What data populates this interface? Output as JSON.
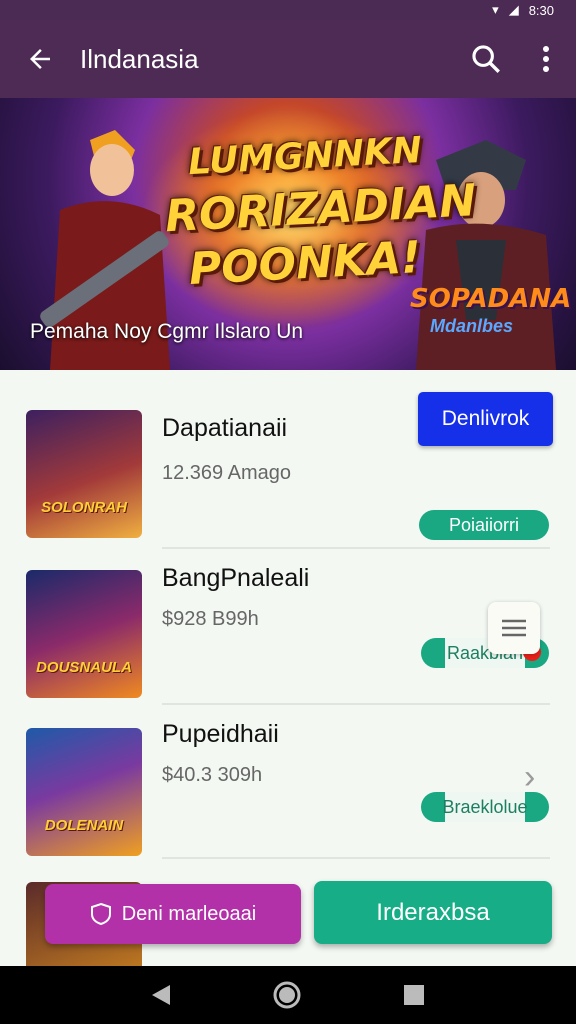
{
  "status": {
    "time": "8:30"
  },
  "appbar": {
    "title": "Ilndanasia",
    "back_icon": "arrow-left-icon",
    "search_icon": "search-icon",
    "more_icon": "more-vertical-icon"
  },
  "banner": {
    "line1": "LUMGNNKN",
    "line2": "RORIZADIAN",
    "line3": "POONKA!",
    "caption": "Pemaha Noy Cgmr Ilslaro Un",
    "logo": "SOPADANA",
    "logo_sub": "Mdanlbes"
  },
  "items": [
    {
      "name": "Dapatianaii",
      "sub": "12.369 Amago",
      "thumb_label": "SOLONRAH",
      "action": "Denlivrok",
      "tag": "Poiaiiorri"
    },
    {
      "name": "BangPnaleali",
      "sub": "$928 B99h",
      "thumb_label": "DOUSNAULA",
      "tag": "Raakbian"
    },
    {
      "name": "Pupeidhaii",
      "sub": "$40.3 309h",
      "thumb_label": "DOLENAIN",
      "tag": "Braeklolue"
    }
  ],
  "fabs": {
    "left_label": "Deni marleoaai",
    "right_label": "Irderaxbsa"
  },
  "colors": {
    "appbar": "#4d2b55",
    "primary_blue": "#1530e8",
    "accent_green": "#17ad86",
    "magenta": "#b231a8"
  }
}
